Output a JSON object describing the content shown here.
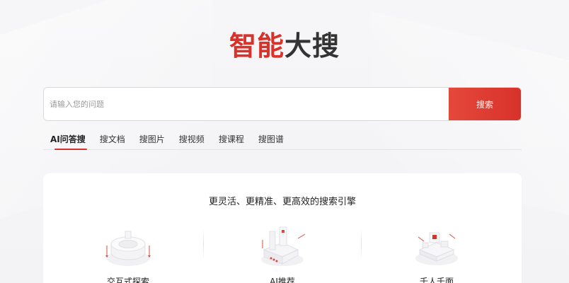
{
  "logo": {
    "part1": "智能",
    "part2": "大搜"
  },
  "search": {
    "placeholder": "请输入您的问题",
    "value": "",
    "button_label": "搜索"
  },
  "tabs": [
    {
      "label": "AI问答搜",
      "active": true
    },
    {
      "label": "搜文档",
      "active": false
    },
    {
      "label": "搜图片",
      "active": false
    },
    {
      "label": "搜视频",
      "active": false
    },
    {
      "label": "搜课程",
      "active": false
    },
    {
      "label": "搜图谱",
      "active": false
    }
  ],
  "card": {
    "title": "更灵活、更精准、更高效的搜索引擎",
    "features": [
      {
        "label": "交互式探索",
        "icon": "interactive-explore-illustration"
      },
      {
        "label": "AI推荐",
        "icon": "ai-recommend-illustration"
      },
      {
        "label": "千人千面",
        "icon": "personalized-illustration"
      }
    ]
  },
  "colors": {
    "accent": "#d8322a",
    "text": "#222222",
    "background": "#f5f5f7"
  }
}
